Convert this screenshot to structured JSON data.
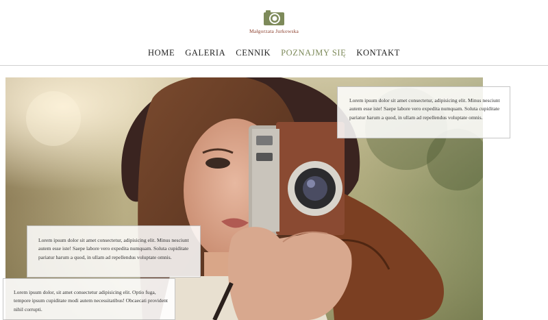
{
  "brand": {
    "name": "Małgorzata Jurkowska",
    "logo_icon": "camera-icon",
    "accent_color": "#7d8a5a",
    "name_color": "#8a3d2a"
  },
  "nav": {
    "items": [
      {
        "label": "HOME",
        "active": false
      },
      {
        "label": "GALERIA",
        "active": false
      },
      {
        "label": "CENNIK",
        "active": false
      },
      {
        "label": "POZNAJMY SIĘ",
        "active": true
      },
      {
        "label": "KONTAKT",
        "active": false
      }
    ]
  },
  "hero": {
    "image": "woman-with-camera-photo"
  },
  "cards": [
    {
      "text": "Lorem ipsum dolor sit amet consectetur, adipisicing elit. Minus nesciunt autem esse iste! Saepe labore vero expedita numquam. Soluta cupiditate pariatur harum a quod, in ullam ad repellendus voluptate omnis."
    },
    {
      "text": "Lorem ipsum dolor sit amet consectetur, adipisicing elit. Minus nesciunt autem esse iste! Saepe labore vero expedita numquam. Soluta cupiditate pariatur harum a quod, in ullam ad repellendus voluptate omnis."
    },
    {
      "text": "Lorem ipsum dolor, sit amet consectetur adipisicing elit. Optio fuga, tempore ipsum cupiditate modi autem necessitatibus! Obcaecati provident nihil corrupti."
    }
  ]
}
